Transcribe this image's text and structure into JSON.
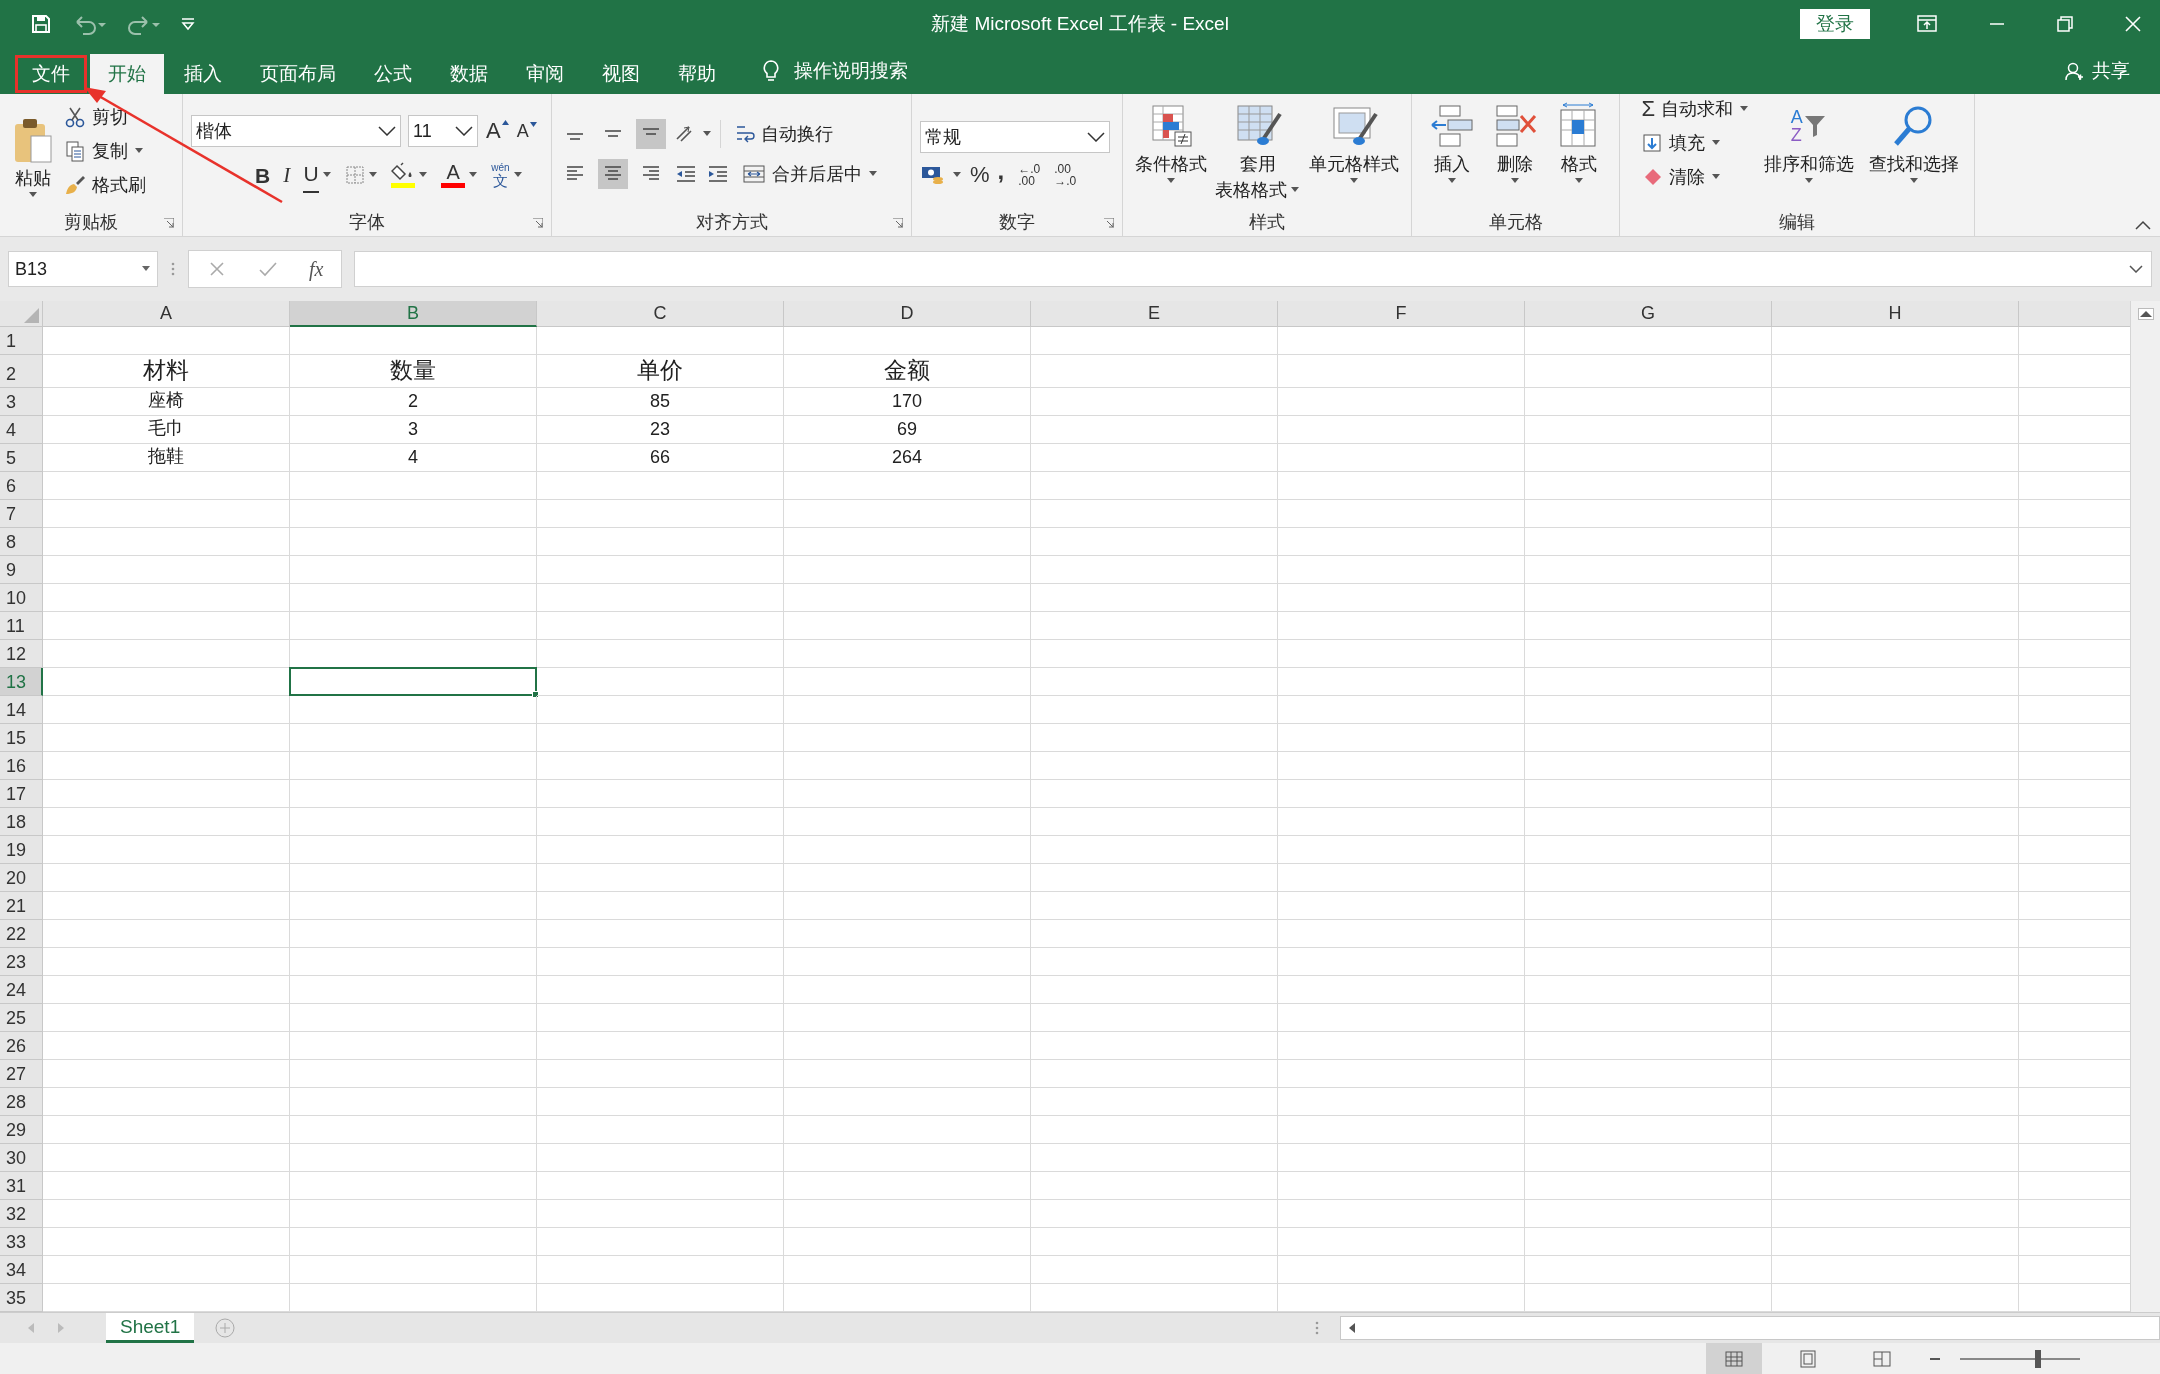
{
  "window": {
    "title": "新建 Microsoft Excel 工作表  -  Excel",
    "login": "登录"
  },
  "tabs": [
    {
      "label": "文件",
      "selected": false,
      "highlighted": true
    },
    {
      "label": "开始",
      "selected": true,
      "highlighted": false
    },
    {
      "label": "插入",
      "selected": false,
      "highlighted": false
    },
    {
      "label": "页面布局",
      "selected": false,
      "highlighted": false
    },
    {
      "label": "公式",
      "selected": false,
      "highlighted": false
    },
    {
      "label": "数据",
      "selected": false,
      "highlighted": false
    },
    {
      "label": "审阅",
      "selected": false,
      "highlighted": false
    },
    {
      "label": "视图",
      "selected": false,
      "highlighted": false
    },
    {
      "label": "帮助",
      "selected": false,
      "highlighted": false
    }
  ],
  "tell_me": "操作说明搜索",
  "share": "共享",
  "ribbon": {
    "clipboard": {
      "label": "剪贴板",
      "paste": "粘贴",
      "items": [
        {
          "label": "剪切",
          "kind": "cut",
          "dropdown": false
        },
        {
          "label": "复制",
          "kind": "copy",
          "dropdown": true
        },
        {
          "label": "格式刷",
          "kind": "brush",
          "dropdown": false
        }
      ]
    },
    "font": {
      "label": "字体",
      "font_name": "楷体",
      "font_size": "11",
      "grow": "A",
      "shrink": "A",
      "bold": "B",
      "italic": "I",
      "underline": "U",
      "fill": {
        "color": "#ffff00"
      },
      "font_color": {
        "glyph": "A",
        "color": "#ff0000"
      },
      "phonetic_top": "wén",
      "phonetic_bottom": "文"
    },
    "alignment": {
      "label": "对齐方式",
      "vertical": [
        {
          "kind": "top",
          "selected": false
        },
        {
          "kind": "middle",
          "selected": false
        },
        {
          "kind": "bottom",
          "selected": true
        }
      ],
      "horizontal": [
        {
          "kind": "left",
          "selected": false
        },
        {
          "kind": "center",
          "selected": true
        },
        {
          "kind": "right",
          "selected": false
        }
      ],
      "wrap": "自动换行",
      "merge": "合并后居中"
    },
    "number": {
      "label": "数字",
      "format": "常规",
      "percent": "%",
      "comma": ",",
      "decimals": [
        {
          "top": "←.0",
          "bottom": ".00"
        },
        {
          "top": ".00",
          "bottom": "→.0"
        }
      ]
    },
    "styles": {
      "label": "样式",
      "buttons": [
        {
          "lines": [
            "条件格式"
          ],
          "kind": "conditional"
        },
        {
          "lines": [
            "套用",
            "表格格式"
          ],
          "kind": "table"
        },
        {
          "lines": [
            "单元格样式"
          ],
          "kind": "cellstyle"
        }
      ]
    },
    "cells": {
      "label": "单元格",
      "buttons": [
        {
          "lines": [
            "插入"
          ],
          "kind": "insert"
        },
        {
          "lines": [
            "删除"
          ],
          "kind": "delete"
        },
        {
          "lines": [
            "格式"
          ],
          "kind": "format"
        }
      ]
    },
    "editing": {
      "label": "编辑",
      "sigma": "Σ",
      "items": [
        {
          "label": "自动求和",
          "kind": "sum"
        },
        {
          "label": "填充",
          "kind": "fill"
        },
        {
          "label": "清除",
          "kind": "clear"
        }
      ],
      "sort": "排序和筛选",
      "sort_letters": [
        "A",
        "Z"
      ],
      "find": "查找和选择"
    }
  },
  "formula_bar": {
    "name_box": "B13",
    "fx": "fx"
  },
  "sheet": {
    "columns": [
      {
        "label": "A",
        "selected": false
      },
      {
        "label": "B",
        "selected": true
      },
      {
        "label": "C",
        "selected": false
      },
      {
        "label": "D",
        "selected": false
      },
      {
        "label": "E",
        "selected": false
      },
      {
        "label": "F",
        "selected": false
      },
      {
        "label": "G",
        "selected": false
      },
      {
        "label": "H",
        "selected": false
      }
    ],
    "rows": [
      {
        "number": "1",
        "kind": "empty",
        "selected": false
      },
      {
        "number": "2",
        "kind": "header",
        "selected": false,
        "cells": [
          "材料",
          "数量",
          "单价",
          "金额"
        ]
      },
      {
        "number": "3",
        "kind": "data",
        "selected": false,
        "cells": [
          "座椅",
          "2",
          "85",
          "170"
        ]
      },
      {
        "number": "4",
        "kind": "data",
        "selected": false,
        "cells": [
          "毛巾",
          "3",
          "23",
          "69"
        ]
      },
      {
        "number": "5",
        "kind": "data",
        "selected": false,
        "cells": [
          "拖鞋",
          "4",
          "66",
          "264"
        ]
      },
      {
        "number": "6",
        "kind": "empty",
        "selected": false
      },
      {
        "number": "7",
        "kind": "empty",
        "selected": false
      },
      {
        "number": "8",
        "kind": "empty",
        "selected": false
      },
      {
        "number": "9",
        "kind": "empty",
        "selected": false
      },
      {
        "number": "10",
        "kind": "empty",
        "selected": false
      },
      {
        "number": "11",
        "kind": "empty",
        "selected": false
      },
      {
        "number": "12",
        "kind": "empty",
        "selected": false
      },
      {
        "number": "13",
        "kind": "empty",
        "selected": true
      },
      {
        "number": "14",
        "kind": "empty",
        "selected": false
      },
      {
        "number": "15",
        "kind": "empty",
        "selected": false
      },
      {
        "number": "16",
        "kind": "empty",
        "selected": false
      },
      {
        "number": "17",
        "kind": "empty",
        "selected": false
      },
      {
        "number": "18",
        "kind": "empty",
        "selected": false
      },
      {
        "number": "19",
        "kind": "empty",
        "selected": false
      },
      {
        "number": "20",
        "kind": "empty",
        "selected": false
      },
      {
        "number": "21",
        "kind": "empty",
        "selected": false
      },
      {
        "number": "22",
        "kind": "empty",
        "selected": false
      },
      {
        "number": "23",
        "kind": "empty",
        "selected": false
      },
      {
        "number": "24",
        "kind": "empty",
        "selected": false
      },
      {
        "number": "25",
        "kind": "empty",
        "selected": false
      },
      {
        "number": "26",
        "kind": "empty",
        "selected": false
      },
      {
        "number": "27",
        "kind": "empty",
        "selected": false
      },
      {
        "number": "28",
        "kind": "empty",
        "selected": false
      },
      {
        "number": "29",
        "kind": "empty",
        "selected": false
      },
      {
        "number": "30",
        "kind": "empty",
        "selected": false
      },
      {
        "number": "31",
        "kind": "empty",
        "selected": false
      },
      {
        "number": "32",
        "kind": "empty",
        "selected": false
      },
      {
        "number": "33",
        "kind": "empty",
        "selected": false
      },
      {
        "number": "34",
        "kind": "empty",
        "selected": false
      },
      {
        "number": "35",
        "kind": "empty",
        "selected": false
      }
    ]
  },
  "sheet_tabs": [
    {
      "label": "Sheet1",
      "selected": true
    }
  ],
  "status_bar": {
    "views": [
      {
        "kind": "normal",
        "selected": true
      },
      {
        "kind": "layout",
        "selected": false
      },
      {
        "kind": "pagebreak",
        "selected": false
      }
    ],
    "zoom": {
      "level": 0.65
    }
  },
  "annotations": [
    {
      "kind": "arrow"
    }
  ]
}
